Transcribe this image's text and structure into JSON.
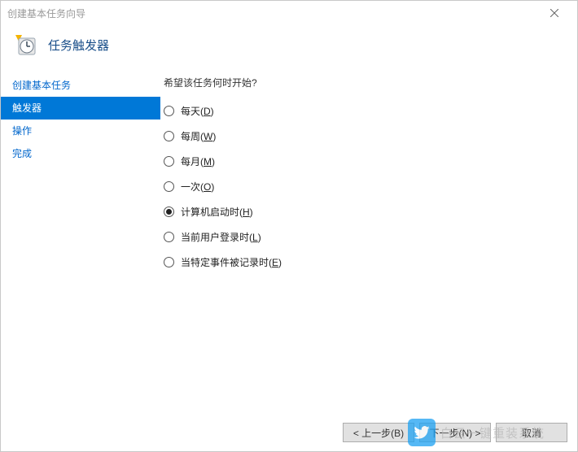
{
  "window": {
    "title": "创建基本任务向导"
  },
  "header": {
    "page_title": "任务触发器"
  },
  "sidebar": {
    "items": [
      {
        "label": "创建基本任务",
        "selected": false
      },
      {
        "label": "触发器",
        "selected": true
      },
      {
        "label": "操作",
        "selected": false
      },
      {
        "label": "完成",
        "selected": false
      }
    ]
  },
  "content": {
    "prompt": "希望该任务何时开始?",
    "options": [
      {
        "label": "每天",
        "hotkey": "D",
        "checked": false
      },
      {
        "label": "每周",
        "hotkey": "W",
        "checked": false
      },
      {
        "label": "每月",
        "hotkey": "M",
        "checked": false
      },
      {
        "label": "一次",
        "hotkey": "O",
        "checked": false
      },
      {
        "label": "计算机启动时",
        "hotkey": "H",
        "checked": true
      },
      {
        "label": "当前用户登录时",
        "hotkey": "L",
        "checked": false
      },
      {
        "label": "当特定事件被记录时",
        "hotkey": "E",
        "checked": false
      }
    ]
  },
  "footer": {
    "back_label": "< 上一步(B)",
    "next_label": "下一步(N) >",
    "cancel_label": "取消"
  },
  "watermark": {
    "text": "白云一键重装系统"
  }
}
